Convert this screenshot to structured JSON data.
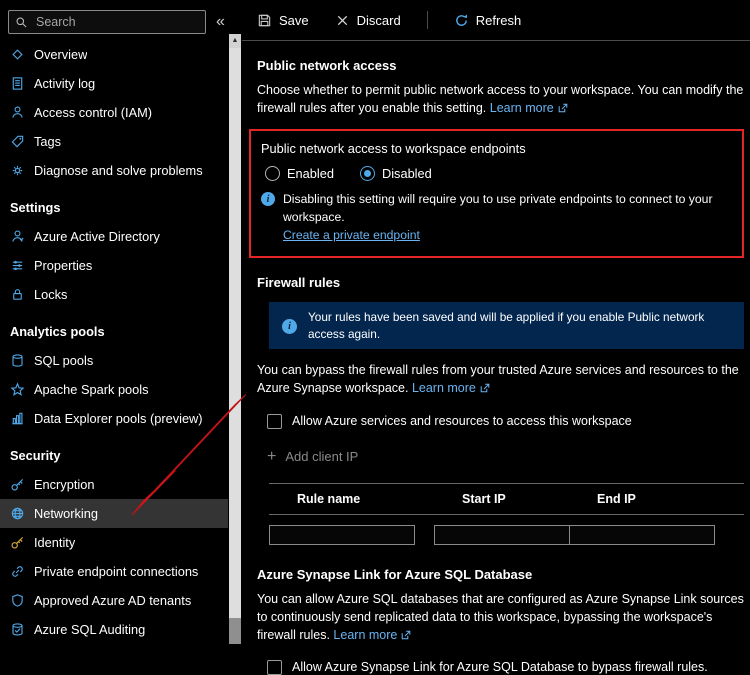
{
  "colors": {
    "accent": "#4fa8e8",
    "annotation_red": "#e42527",
    "banner_bg": "#03264f",
    "link": "#6ab4f2",
    "selected_bg": "#343434"
  },
  "sidebar": {
    "search_placeholder": "Search",
    "collapse_glyph": "«",
    "groups": [
      {
        "header": "",
        "items": [
          {
            "label": "Overview",
            "icon": "diamond"
          },
          {
            "label": "Activity log",
            "icon": "doc"
          },
          {
            "label": "Access control (IAM)",
            "icon": "person"
          },
          {
            "label": "Tags",
            "icon": "tag"
          },
          {
            "label": "Diagnose and solve problems",
            "icon": "gear"
          }
        ]
      },
      {
        "header": "Settings",
        "items": [
          {
            "label": "Azure Active Directory",
            "icon": "person-badge"
          },
          {
            "label": "Properties",
            "icon": "sliders"
          },
          {
            "label": "Locks",
            "icon": "lock"
          }
        ]
      },
      {
        "header": "Analytics pools",
        "items": [
          {
            "label": "SQL pools",
            "icon": "database"
          },
          {
            "label": "Apache Spark pools",
            "icon": "star"
          },
          {
            "label": "Data Explorer pools (preview)",
            "icon": "chart"
          }
        ]
      },
      {
        "header": "Security",
        "items": [
          {
            "label": "Encryption",
            "icon": "key"
          },
          {
            "label": "Networking",
            "icon": "globe",
            "selected": true
          },
          {
            "label": "Identity",
            "icon": "key-gold"
          },
          {
            "label": "Private endpoint connections",
            "icon": "link"
          },
          {
            "label": "Approved Azure AD tenants",
            "icon": "shield"
          },
          {
            "label": "Azure SQL Auditing",
            "icon": "database-check"
          }
        ]
      }
    ]
  },
  "toolbar": {
    "save": "Save",
    "discard": "Discard",
    "refresh": "Refresh"
  },
  "public_network_access": {
    "heading": "Public network access",
    "desc": "Choose whether to permit public network access to your workspace. You can modify the firewall rules after you enable this setting.",
    "learn_more": "Learn more",
    "sub_heading": "Public network access to workspace endpoints",
    "enabled_label": "Enabled",
    "disabled_label": "Disabled",
    "info_text": "Disabling this setting will require you to use private endpoints to connect to your workspace.",
    "create_link": "Create a private endpoint"
  },
  "firewall": {
    "heading": "Firewall rules",
    "banner": "Your rules have been saved and will be applied if you enable Public network access again.",
    "desc": "You can bypass the firewall rules from your trusted Azure services and resources to the Azure Synapse workspace.",
    "learn_more": "Learn more",
    "allow_services_label": "Allow Azure services and resources to access this workspace",
    "add_client_ip": "Add client IP",
    "table": {
      "headers": [
        "Rule name",
        "Start IP",
        "End IP"
      ]
    }
  },
  "synapse_link": {
    "heading": "Azure Synapse Link for Azure SQL Database",
    "desc": "You can allow Azure SQL databases that are configured as Azure Synapse Link sources to continuously send replicated data to this workspace, bypassing the workspace's firewall rules.",
    "learn_more": "Learn more",
    "bypass_label": "Allow Azure Synapse Link for Azure SQL Database to bypass firewall rules."
  }
}
